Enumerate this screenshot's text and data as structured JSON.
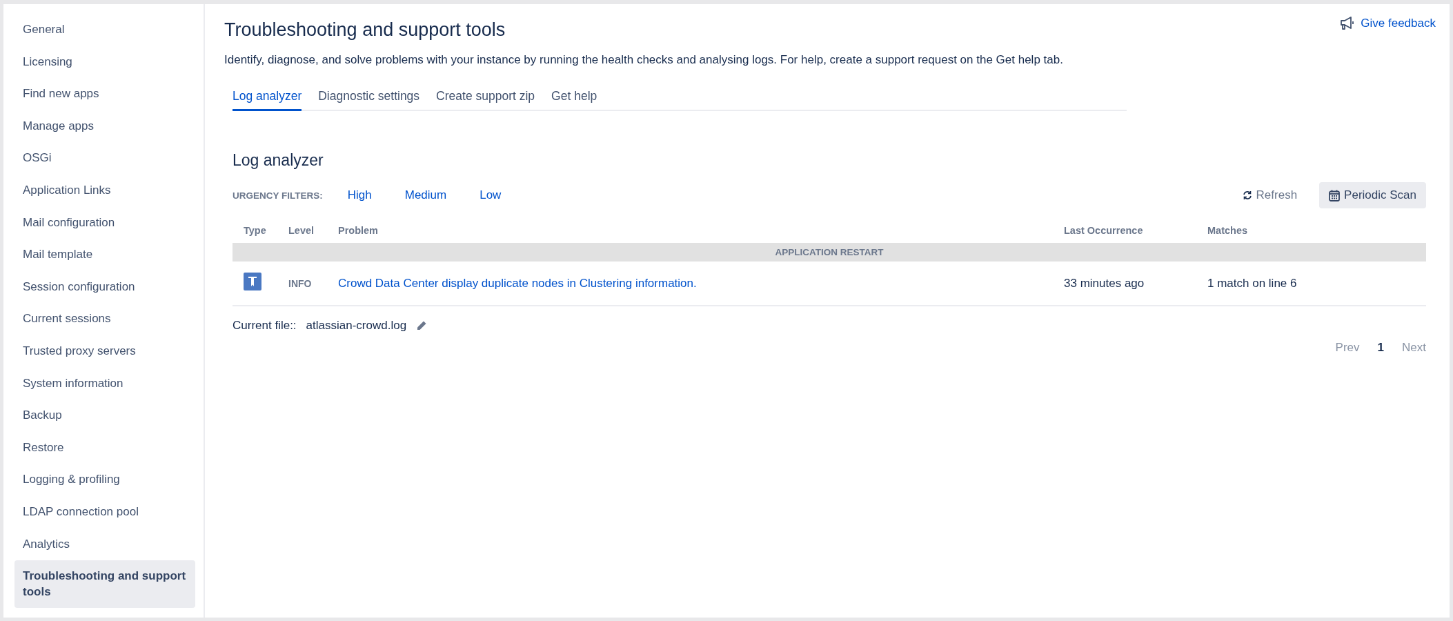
{
  "sidebar": {
    "items": [
      {
        "label": "General",
        "selected": false
      },
      {
        "label": "Licensing",
        "selected": false
      },
      {
        "label": "Find new apps",
        "selected": false
      },
      {
        "label": "Manage apps",
        "selected": false
      },
      {
        "label": "OSGi",
        "selected": false
      },
      {
        "label": "Application Links",
        "selected": false
      },
      {
        "label": "Mail configuration",
        "selected": false
      },
      {
        "label": "Mail template",
        "selected": false
      },
      {
        "label": "Session configuration",
        "selected": false
      },
      {
        "label": "Current sessions",
        "selected": false
      },
      {
        "label": "Trusted proxy servers",
        "selected": false
      },
      {
        "label": "System information",
        "selected": false
      },
      {
        "label": "Backup",
        "selected": false
      },
      {
        "label": "Restore",
        "selected": false
      },
      {
        "label": "Logging & profiling",
        "selected": false
      },
      {
        "label": "LDAP connection pool",
        "selected": false
      },
      {
        "label": "Analytics",
        "selected": false
      },
      {
        "label": "Troubleshooting and support tools",
        "selected": true
      }
    ]
  },
  "page": {
    "title": "Troubleshooting and support tools",
    "description": "Identify, diagnose, and solve problems with your instance by running the health checks and analysing logs. For help, create a support request on the Get help tab.",
    "feedback": "Give feedback"
  },
  "tabs": [
    {
      "label": "Log analyzer",
      "selected": true
    },
    {
      "label": "Diagnostic settings",
      "selected": false
    },
    {
      "label": "Create support zip",
      "selected": false
    },
    {
      "label": "Get help",
      "selected": false
    }
  ],
  "log_analyzer": {
    "heading": "Log analyzer",
    "filters_label": "URGENCY FILTERS:",
    "filters": [
      "High",
      "Medium",
      "Low"
    ],
    "refresh": "Refresh",
    "periodic_scan": "Periodic Scan",
    "table": {
      "columns": [
        "Type",
        "Level",
        "Problem",
        "Last Occurrence",
        "Matches"
      ],
      "groups": [
        {
          "title": "APPLICATION RESTART",
          "rows": [
            {
              "level": "INFO",
              "problem": "Crowd Data Center display duplicate nodes in Clustering information.",
              "last_occurrence": "33 minutes ago",
              "matches": "1 match on line 6"
            }
          ]
        }
      ]
    },
    "current_file_label": "Current file::",
    "current_file": "atlassian-crowd.log",
    "pagination": {
      "prev": "Prev",
      "pages": [
        {
          "label": "1",
          "selected": true
        }
      ],
      "next": "Next"
    }
  }
}
